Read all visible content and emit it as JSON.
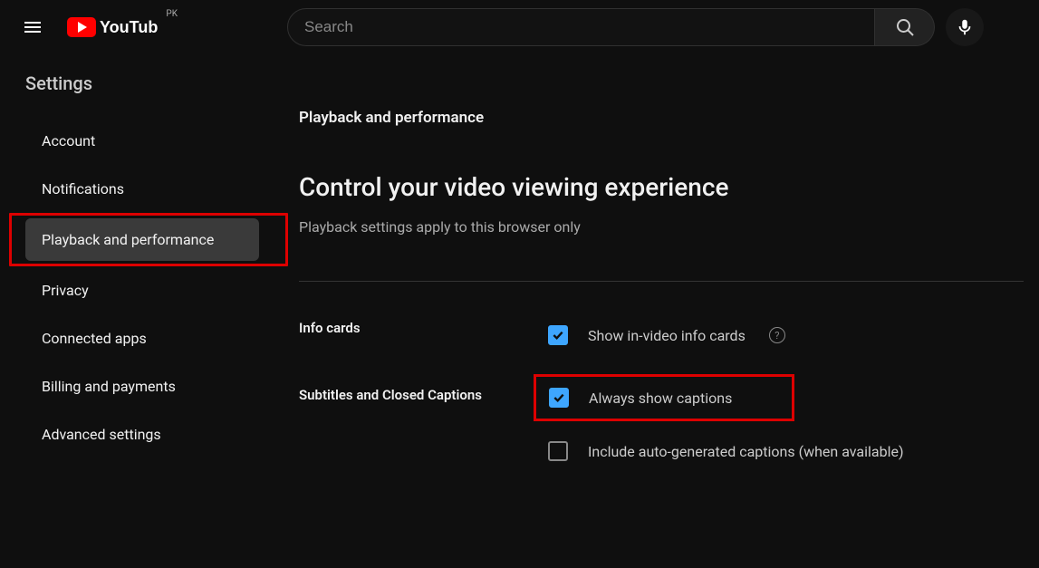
{
  "header": {
    "country_code": "PK",
    "search_placeholder": "Search"
  },
  "sidebar": {
    "title": "Settings",
    "items": [
      {
        "label": "Account",
        "active": false
      },
      {
        "label": "Notifications",
        "active": false
      },
      {
        "label": "Playback and performance",
        "active": true
      },
      {
        "label": "Privacy",
        "active": false
      },
      {
        "label": "Connected apps",
        "active": false
      },
      {
        "label": "Billing and payments",
        "active": false
      },
      {
        "label": "Advanced settings",
        "active": false
      }
    ]
  },
  "main": {
    "section_title": "Playback and performance",
    "heading": "Control your video viewing experience",
    "subheading": "Playback settings apply to this browser only",
    "info_cards_label": "Info cards",
    "info_cards_option": "Show in-video info cards",
    "captions_label": "Subtitles and Closed Captions",
    "captions_option_1": "Always show captions",
    "captions_option_2": "Include auto-generated captions (when available)"
  }
}
